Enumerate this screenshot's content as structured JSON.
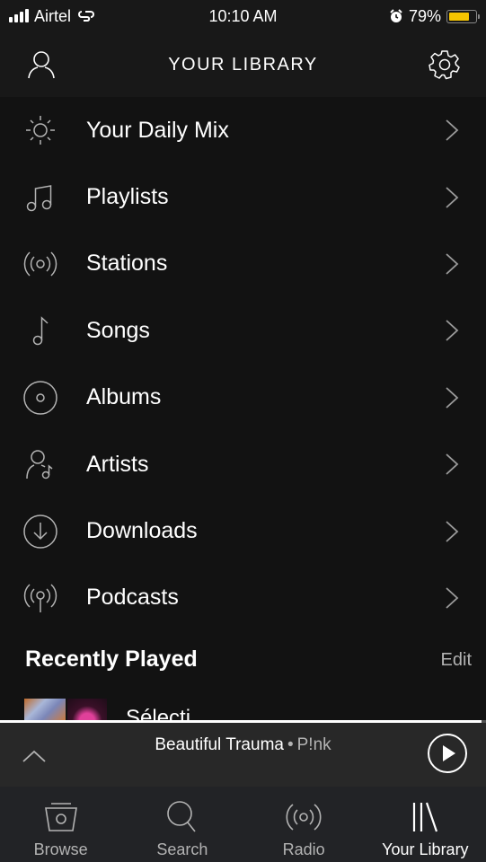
{
  "status_bar": {
    "carrier": "Airtel",
    "signal_bars": 4,
    "time": "10:10 AM",
    "alarm_icon": "alarm-clock-icon",
    "battery_percent_label": "79%",
    "battery_level": 0.79,
    "battery_color": "#f5c400"
  },
  "header": {
    "title": "YOUR LIBRARY",
    "left_icon": "profile-icon",
    "right_icon": "settings-gear-icon"
  },
  "menu": {
    "items": [
      {
        "label": "Your Daily Mix",
        "icon": "sun-icon"
      },
      {
        "label": "Playlists",
        "icon": "music-notes-icon"
      },
      {
        "label": "Stations",
        "icon": "radio-waves-icon"
      },
      {
        "label": "Songs",
        "icon": "music-note-icon"
      },
      {
        "label": "Albums",
        "icon": "album-disc-icon"
      },
      {
        "label": "Artists",
        "icon": "artist-icon"
      },
      {
        "label": "Downloads",
        "icon": "download-circle-icon"
      },
      {
        "label": "Podcasts",
        "icon": "podcast-icon"
      }
    ]
  },
  "recently_played": {
    "title": "Recently Played",
    "edit_label": "Edit",
    "items": [
      {
        "name": "Sélecti"
      }
    ]
  },
  "now_playing": {
    "track": "Beautiful Trauma",
    "separator": "•",
    "artist": "P!nk",
    "progress": 0.99,
    "state": "paused"
  },
  "tabbar": {
    "tabs": [
      {
        "label": "Browse",
        "icon": "browse-icon",
        "active": false
      },
      {
        "label": "Search",
        "icon": "search-icon",
        "active": false
      },
      {
        "label": "Radio",
        "icon": "radio-icon",
        "active": false
      },
      {
        "label": "Your Library",
        "icon": "library-icon",
        "active": true
      }
    ]
  }
}
